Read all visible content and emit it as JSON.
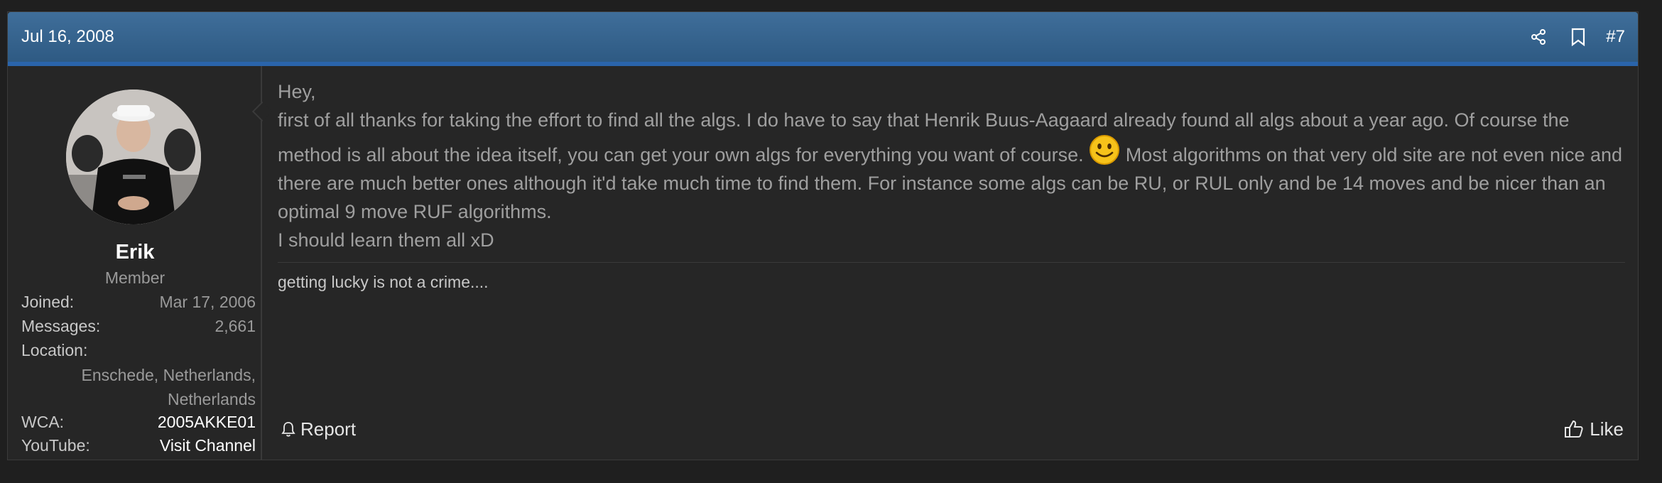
{
  "post": {
    "date": "Jul 16, 2008",
    "number": "#7",
    "header_icons": [
      "share-icon",
      "bookmark-icon"
    ]
  },
  "user": {
    "name": "Erik",
    "title": "Member",
    "info": {
      "joined_label": "Joined:",
      "joined_value": "Mar 17, 2006",
      "messages_label": "Messages:",
      "messages_value": "2,661",
      "location_label": "Location:",
      "location_value": "Enschede, Netherlands, Netherlands",
      "wca_label": "WCA:",
      "wca_value": "2005AKKE01",
      "youtube_label": "YouTube:",
      "youtube_value": "Visit Channel"
    }
  },
  "message": {
    "line1": "Hey,",
    "part1": "first of all thanks for taking the effort to find all the algs. I do have to say that Henrik Buus-Aagaard already found all algs about a year ago. Of course the method is all about the idea itself, you can get your own algs for everything you want of course.",
    "smiley_icon": "smiley-icon",
    "part2": "Most algorithms on that very old site are not even nice and there are much better ones although it'd take much time to find them. For instance some algs can be RU, or RUL only and be 14 moves and be nicer than an optimal 9 move RUF algorithms.",
    "line_last": "I should learn them all xD"
  },
  "signature": "getting lucky is not a crime....",
  "actions": {
    "report_label": "Report",
    "like_label": "Like"
  },
  "colors": {
    "header": "#2e5a83",
    "accent_line": "#2a64ab",
    "background": "#262626"
  }
}
